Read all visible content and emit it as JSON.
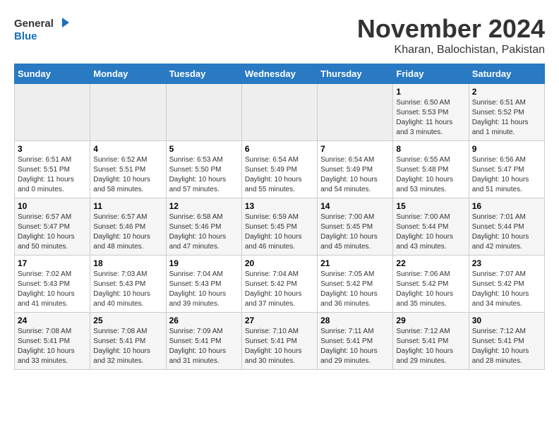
{
  "header": {
    "logo_general": "General",
    "logo_blue": "Blue",
    "title": "November 2024",
    "subtitle": "Kharan, Balochistan, Pakistan"
  },
  "days_of_week": [
    "Sunday",
    "Monday",
    "Tuesday",
    "Wednesday",
    "Thursday",
    "Friday",
    "Saturday"
  ],
  "weeks": [
    [
      {
        "day": "",
        "empty": true
      },
      {
        "day": "",
        "empty": true
      },
      {
        "day": "",
        "empty": true
      },
      {
        "day": "",
        "empty": true
      },
      {
        "day": "",
        "empty": true
      },
      {
        "day": "1",
        "sunrise": "Sunrise: 6:50 AM",
        "sunset": "Sunset: 5:53 PM",
        "daylight": "Daylight: 11 hours and 3 minutes."
      },
      {
        "day": "2",
        "sunrise": "Sunrise: 6:51 AM",
        "sunset": "Sunset: 5:52 PM",
        "daylight": "Daylight: 11 hours and 1 minute."
      }
    ],
    [
      {
        "day": "3",
        "sunrise": "Sunrise: 6:51 AM",
        "sunset": "Sunset: 5:51 PM",
        "daylight": "Daylight: 11 hours and 0 minutes."
      },
      {
        "day": "4",
        "sunrise": "Sunrise: 6:52 AM",
        "sunset": "Sunset: 5:51 PM",
        "daylight": "Daylight: 10 hours and 58 minutes."
      },
      {
        "day": "5",
        "sunrise": "Sunrise: 6:53 AM",
        "sunset": "Sunset: 5:50 PM",
        "daylight": "Daylight: 10 hours and 57 minutes."
      },
      {
        "day": "6",
        "sunrise": "Sunrise: 6:54 AM",
        "sunset": "Sunset: 5:49 PM",
        "daylight": "Daylight: 10 hours and 55 minutes."
      },
      {
        "day": "7",
        "sunrise": "Sunrise: 6:54 AM",
        "sunset": "Sunset: 5:49 PM",
        "daylight": "Daylight: 10 hours and 54 minutes."
      },
      {
        "day": "8",
        "sunrise": "Sunrise: 6:55 AM",
        "sunset": "Sunset: 5:48 PM",
        "daylight": "Daylight: 10 hours and 53 minutes."
      },
      {
        "day": "9",
        "sunrise": "Sunrise: 6:56 AM",
        "sunset": "Sunset: 5:47 PM",
        "daylight": "Daylight: 10 hours and 51 minutes."
      }
    ],
    [
      {
        "day": "10",
        "sunrise": "Sunrise: 6:57 AM",
        "sunset": "Sunset: 5:47 PM",
        "daylight": "Daylight: 10 hours and 50 minutes."
      },
      {
        "day": "11",
        "sunrise": "Sunrise: 6:57 AM",
        "sunset": "Sunset: 5:46 PM",
        "daylight": "Daylight: 10 hours and 48 minutes."
      },
      {
        "day": "12",
        "sunrise": "Sunrise: 6:58 AM",
        "sunset": "Sunset: 5:46 PM",
        "daylight": "Daylight: 10 hours and 47 minutes."
      },
      {
        "day": "13",
        "sunrise": "Sunrise: 6:59 AM",
        "sunset": "Sunset: 5:45 PM",
        "daylight": "Daylight: 10 hours and 46 minutes."
      },
      {
        "day": "14",
        "sunrise": "Sunrise: 7:00 AM",
        "sunset": "Sunset: 5:45 PM",
        "daylight": "Daylight: 10 hours and 45 minutes."
      },
      {
        "day": "15",
        "sunrise": "Sunrise: 7:00 AM",
        "sunset": "Sunset: 5:44 PM",
        "daylight": "Daylight: 10 hours and 43 minutes."
      },
      {
        "day": "16",
        "sunrise": "Sunrise: 7:01 AM",
        "sunset": "Sunset: 5:44 PM",
        "daylight": "Daylight: 10 hours and 42 minutes."
      }
    ],
    [
      {
        "day": "17",
        "sunrise": "Sunrise: 7:02 AM",
        "sunset": "Sunset: 5:43 PM",
        "daylight": "Daylight: 10 hours and 41 minutes."
      },
      {
        "day": "18",
        "sunrise": "Sunrise: 7:03 AM",
        "sunset": "Sunset: 5:43 PM",
        "daylight": "Daylight: 10 hours and 40 minutes."
      },
      {
        "day": "19",
        "sunrise": "Sunrise: 7:04 AM",
        "sunset": "Sunset: 5:43 PM",
        "daylight": "Daylight: 10 hours and 39 minutes."
      },
      {
        "day": "20",
        "sunrise": "Sunrise: 7:04 AM",
        "sunset": "Sunset: 5:42 PM",
        "daylight": "Daylight: 10 hours and 37 minutes."
      },
      {
        "day": "21",
        "sunrise": "Sunrise: 7:05 AM",
        "sunset": "Sunset: 5:42 PM",
        "daylight": "Daylight: 10 hours and 36 minutes."
      },
      {
        "day": "22",
        "sunrise": "Sunrise: 7:06 AM",
        "sunset": "Sunset: 5:42 PM",
        "daylight": "Daylight: 10 hours and 35 minutes."
      },
      {
        "day": "23",
        "sunrise": "Sunrise: 7:07 AM",
        "sunset": "Sunset: 5:42 PM",
        "daylight": "Daylight: 10 hours and 34 minutes."
      }
    ],
    [
      {
        "day": "24",
        "sunrise": "Sunrise: 7:08 AM",
        "sunset": "Sunset: 5:41 PM",
        "daylight": "Daylight: 10 hours and 33 minutes."
      },
      {
        "day": "25",
        "sunrise": "Sunrise: 7:08 AM",
        "sunset": "Sunset: 5:41 PM",
        "daylight": "Daylight: 10 hours and 32 minutes."
      },
      {
        "day": "26",
        "sunrise": "Sunrise: 7:09 AM",
        "sunset": "Sunset: 5:41 PM",
        "daylight": "Daylight: 10 hours and 31 minutes."
      },
      {
        "day": "27",
        "sunrise": "Sunrise: 7:10 AM",
        "sunset": "Sunset: 5:41 PM",
        "daylight": "Daylight: 10 hours and 30 minutes."
      },
      {
        "day": "28",
        "sunrise": "Sunrise: 7:11 AM",
        "sunset": "Sunset: 5:41 PM",
        "daylight": "Daylight: 10 hours and 29 minutes."
      },
      {
        "day": "29",
        "sunrise": "Sunrise: 7:12 AM",
        "sunset": "Sunset: 5:41 PM",
        "daylight": "Daylight: 10 hours and 29 minutes."
      },
      {
        "day": "30",
        "sunrise": "Sunrise: 7:12 AM",
        "sunset": "Sunset: 5:41 PM",
        "daylight": "Daylight: 10 hours and 28 minutes."
      }
    ]
  ]
}
